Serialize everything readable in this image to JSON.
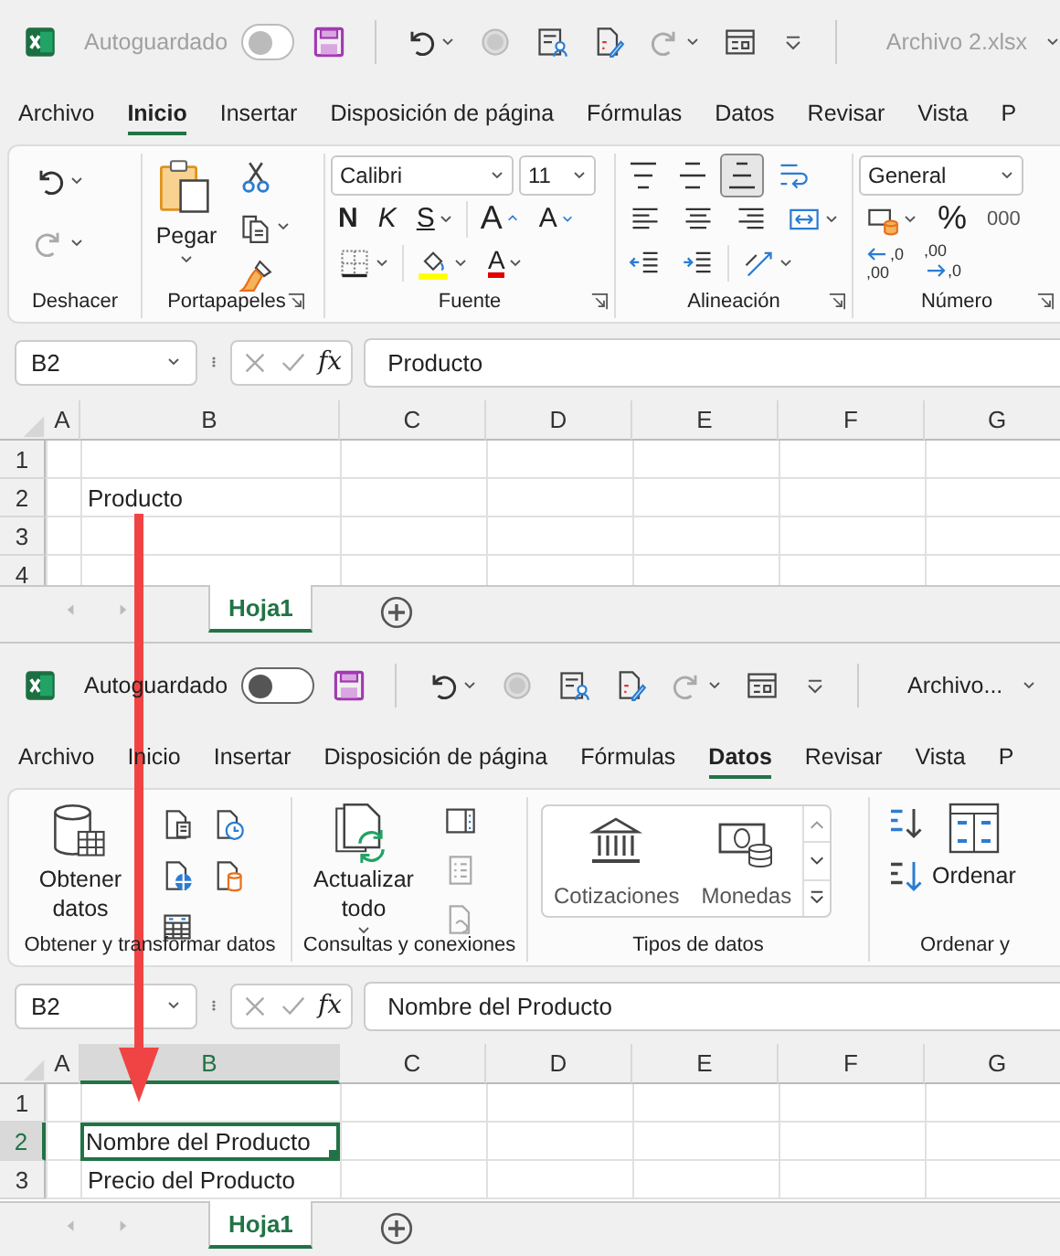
{
  "windows": [
    {
      "active": false,
      "title_bar": {
        "autosave_label": "Autoguardado",
        "autosave_on": false,
        "filename": "Archivo 2.xlsx"
      },
      "tabs": [
        {
          "label": "Archivo",
          "selected": false
        },
        {
          "label": "Inicio",
          "selected": true
        },
        {
          "label": "Insertar",
          "selected": false
        },
        {
          "label": "Disposición de página",
          "selected": false
        },
        {
          "label": "Fórmulas",
          "selected": false
        },
        {
          "label": "Datos",
          "selected": false
        },
        {
          "label": "Revisar",
          "selected": false
        },
        {
          "label": "Vista",
          "selected": false
        },
        {
          "label": "P",
          "selected": false
        }
      ],
      "ribbon": [
        {
          "kind": "undo",
          "label": "Deshacer",
          "launcher": false
        },
        {
          "kind": "clipboard",
          "label": "Portapapeles",
          "launcher": true,
          "paste": "Pegar"
        },
        {
          "kind": "font",
          "label": "Fuente",
          "launcher": true,
          "font": "Calibri",
          "size": "11",
          "bold": "N",
          "italic": "K",
          "underline": "S",
          "grow": "A",
          "shrink": "A",
          "color_letter": "A"
        },
        {
          "kind": "alignment",
          "label": "Alineación",
          "launcher": true,
          "vertical_align": [
            {
              "kind": "top",
              "selected": false
            },
            {
              "kind": "middle",
              "selected": false
            },
            {
              "kind": "bottom",
              "selected": true
            }
          ]
        },
        {
          "kind": "number",
          "label": "Número",
          "launcher": true,
          "format": "General",
          "percent": "%",
          "thousands": "000",
          "decimals_more": [
            ",0",
            ",00"
          ],
          "decimals_less": [
            ",00",
            ",0"
          ]
        }
      ],
      "formula_bar": {
        "name_box": "B2",
        "fx": "fx",
        "formula": "Producto"
      },
      "grid": {
        "columns": [
          {
            "label": "A",
            "selected": false
          },
          {
            "label": "B",
            "selected": false
          },
          {
            "label": "C",
            "selected": false
          },
          {
            "label": "D",
            "selected": false
          },
          {
            "label": "E",
            "selected": false
          },
          {
            "label": "F",
            "selected": false
          },
          {
            "label": "G",
            "selected": false
          }
        ],
        "rows": [
          {
            "label": "1",
            "selected": false,
            "cells": []
          },
          {
            "label": "2",
            "selected": false,
            "cells": [
              null,
              {
                "text": "Producto",
                "selected": false
              }
            ]
          },
          {
            "label": "3",
            "selected": false,
            "cells": []
          },
          {
            "label": "4",
            "selected": false,
            "cells": []
          }
        ]
      },
      "sheet_tabs": [
        {
          "label": "Hoja1",
          "selected": true
        }
      ]
    },
    {
      "active": true,
      "title_bar": {
        "autosave_label": "Autoguardado",
        "autosave_on": false,
        "filename": "Archivo..."
      },
      "tabs": [
        {
          "label": "Archivo",
          "selected": false
        },
        {
          "label": "Inicio",
          "selected": false
        },
        {
          "label": "Insertar",
          "selected": false
        },
        {
          "label": "Disposición de página",
          "selected": false
        },
        {
          "label": "Fórmulas",
          "selected": false
        },
        {
          "label": "Datos",
          "selected": true
        },
        {
          "label": "Revisar",
          "selected": false
        },
        {
          "label": "Vista",
          "selected": false
        },
        {
          "label": "P",
          "selected": false
        }
      ],
      "ribbon": [
        {
          "kind": "get_data",
          "label": "Obtener y transformar datos",
          "launcher": false,
          "button": "Obtener datos"
        },
        {
          "kind": "queries",
          "label": "Consultas y conexiones",
          "launcher": false,
          "button": "Actualizar todo"
        },
        {
          "kind": "data_types",
          "label": "Tipos de datos",
          "launcher": false,
          "items": [
            "Cotizaciones",
            "Monedas"
          ]
        },
        {
          "kind": "sort",
          "label": "Ordenar y",
          "launcher": false,
          "button": "Ordenar"
        }
      ],
      "formula_bar": {
        "name_box": "B2",
        "fx": "fx",
        "formula": "Nombre del Producto"
      },
      "grid": {
        "columns": [
          {
            "label": "A",
            "selected": false
          },
          {
            "label": "B",
            "selected": true
          },
          {
            "label": "C",
            "selected": false
          },
          {
            "label": "D",
            "selected": false
          },
          {
            "label": "E",
            "selected": false
          },
          {
            "label": "F",
            "selected": false
          },
          {
            "label": "G",
            "selected": false
          }
        ],
        "rows": [
          {
            "label": "1",
            "selected": false,
            "cells": []
          },
          {
            "label": "2",
            "selected": true,
            "cells": [
              null,
              {
                "text": "Nombre del Producto",
                "selected": true
              }
            ]
          },
          {
            "label": "3",
            "selected": false,
            "cells": [
              null,
              {
                "text": "Precio del Producto",
                "selected": false
              }
            ]
          }
        ]
      },
      "sheet_tabs": [
        {
          "label": "Hoja1",
          "selected": true
        }
      ]
    }
  ]
}
